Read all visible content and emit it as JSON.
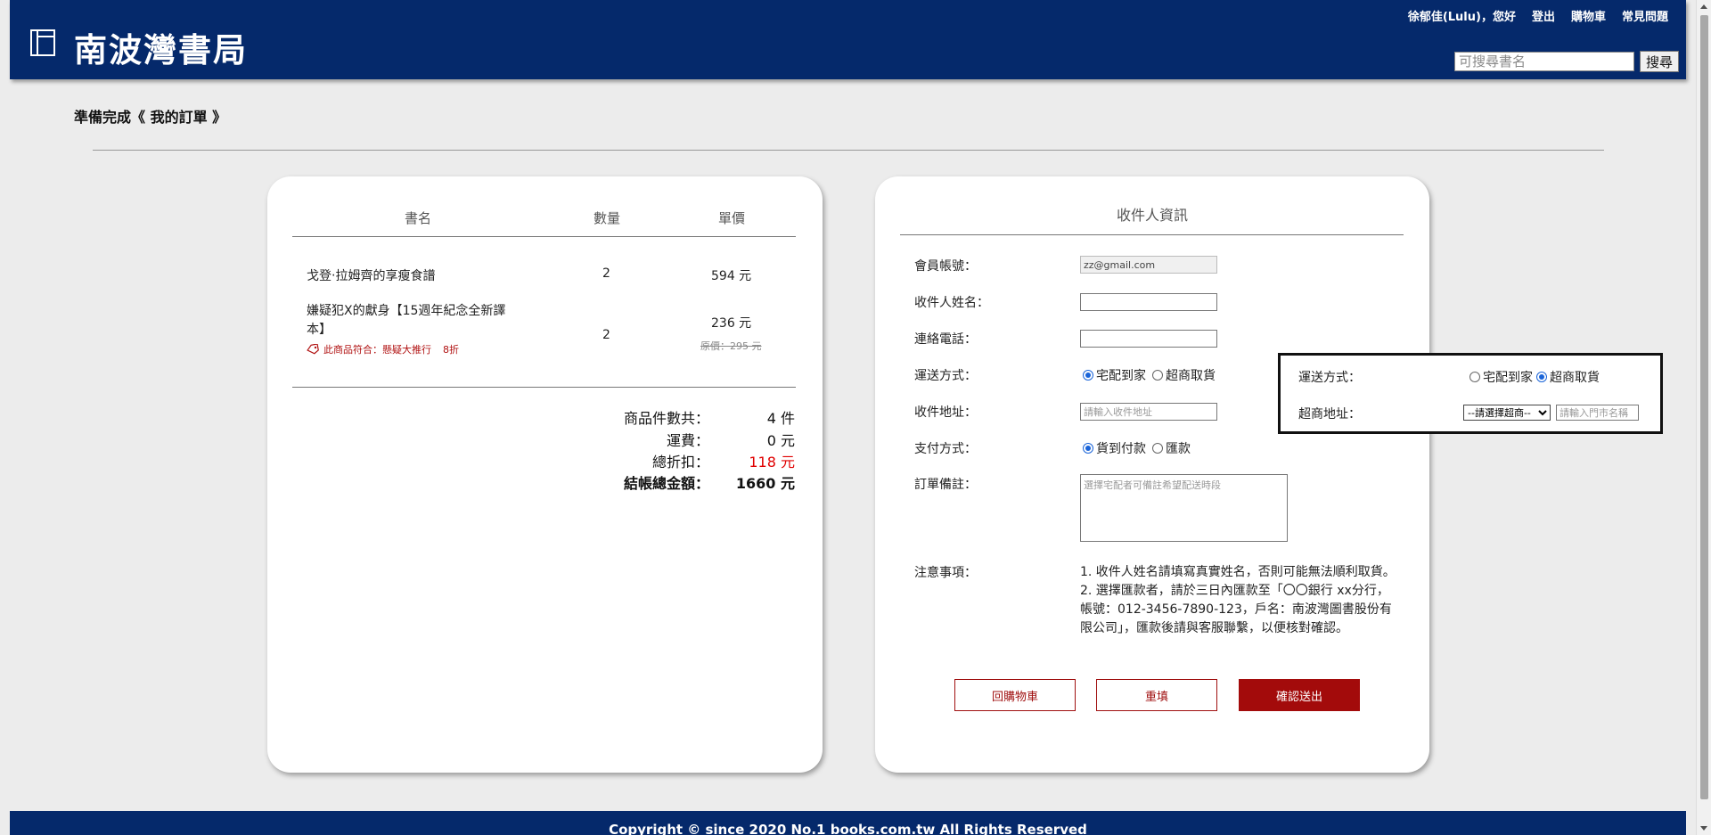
{
  "header": {
    "brand": "南波灣書局",
    "nav": {
      "greeting": "徐郁佳(Lulu)，您好",
      "logout": "登出",
      "cart": "購物車",
      "faq": "常見問題"
    },
    "search": {
      "placeholder": "可搜尋書名",
      "button": "搜尋"
    }
  },
  "page": {
    "title": "準備完成《 我的訂單 》"
  },
  "order": {
    "headers": {
      "name": "書名",
      "qty": "數量",
      "price": "單價"
    },
    "items": [
      {
        "name": "戈登‧拉姆齊的享瘦食譜",
        "qty": "2",
        "price": "594 元"
      },
      {
        "name_line1": "嫌疑犯X的獻身【15週年紀念全新譯",
        "name_line2": "本】",
        "promo": "此商品符合：懸疑大推行",
        "discount": "8折",
        "qty": "2",
        "price": "236 元",
        "original_price": "原價：295 元"
      }
    ],
    "summary": {
      "count_label": "商品件數共：",
      "count_value": "4 件",
      "shipping_label": "運費：",
      "shipping_value": "0 元",
      "discount_label": "總折扣：",
      "discount_value": "118 元",
      "total_label": "結帳總金額：",
      "total_value": "1660 元"
    }
  },
  "form": {
    "title": "收件人資訊",
    "account_label": "會員帳號：",
    "account_value": "zz@gmail.com",
    "name_label": "收件人姓名：",
    "phone_label": "連絡電話：",
    "shipping_label": "運送方式：",
    "shipping_home": "宅配到家",
    "shipping_store": "超商取貨",
    "address_label": "收件地址：",
    "address_placeholder": "請輸入收件地址",
    "payment_label": "支付方式：",
    "payment_cod": "貨到付款",
    "payment_transfer": "匯款",
    "remark_label": "訂單備註：",
    "remark_placeholder": "選擇宅配者可備註希望配送時段",
    "notes_label": "注意事項：",
    "note1": "1. 收件人姓名請填寫真實姓名，否則可能無法順利取貨。",
    "note2": "2. 選擇匯款者，請於三日內匯款至「〇〇銀行 xx分行，帳號：012-3456-7890-123，戶名：南波灣圖書股份有限公司」，匯款後請與客服聯繫，以便核對確認。",
    "btn_back": "回購物車",
    "btn_reset": "重填",
    "btn_submit": "確認送出"
  },
  "popup": {
    "shipping_label": "運送方式：",
    "shipping_home": "宅配到家",
    "shipping_store": "超商取貨",
    "store_label": "超商地址：",
    "store_select": "--請選擇超商--",
    "store_placeholder": "請輸入門市名稱"
  },
  "footer": {
    "copyright": "Copyright © since 2020 No.1 books.com.tw All Rights Reserved"
  },
  "colors": {
    "header_bg": "#05296b",
    "accent_red": "#a30b0b",
    "discount_red": "#e00000"
  }
}
